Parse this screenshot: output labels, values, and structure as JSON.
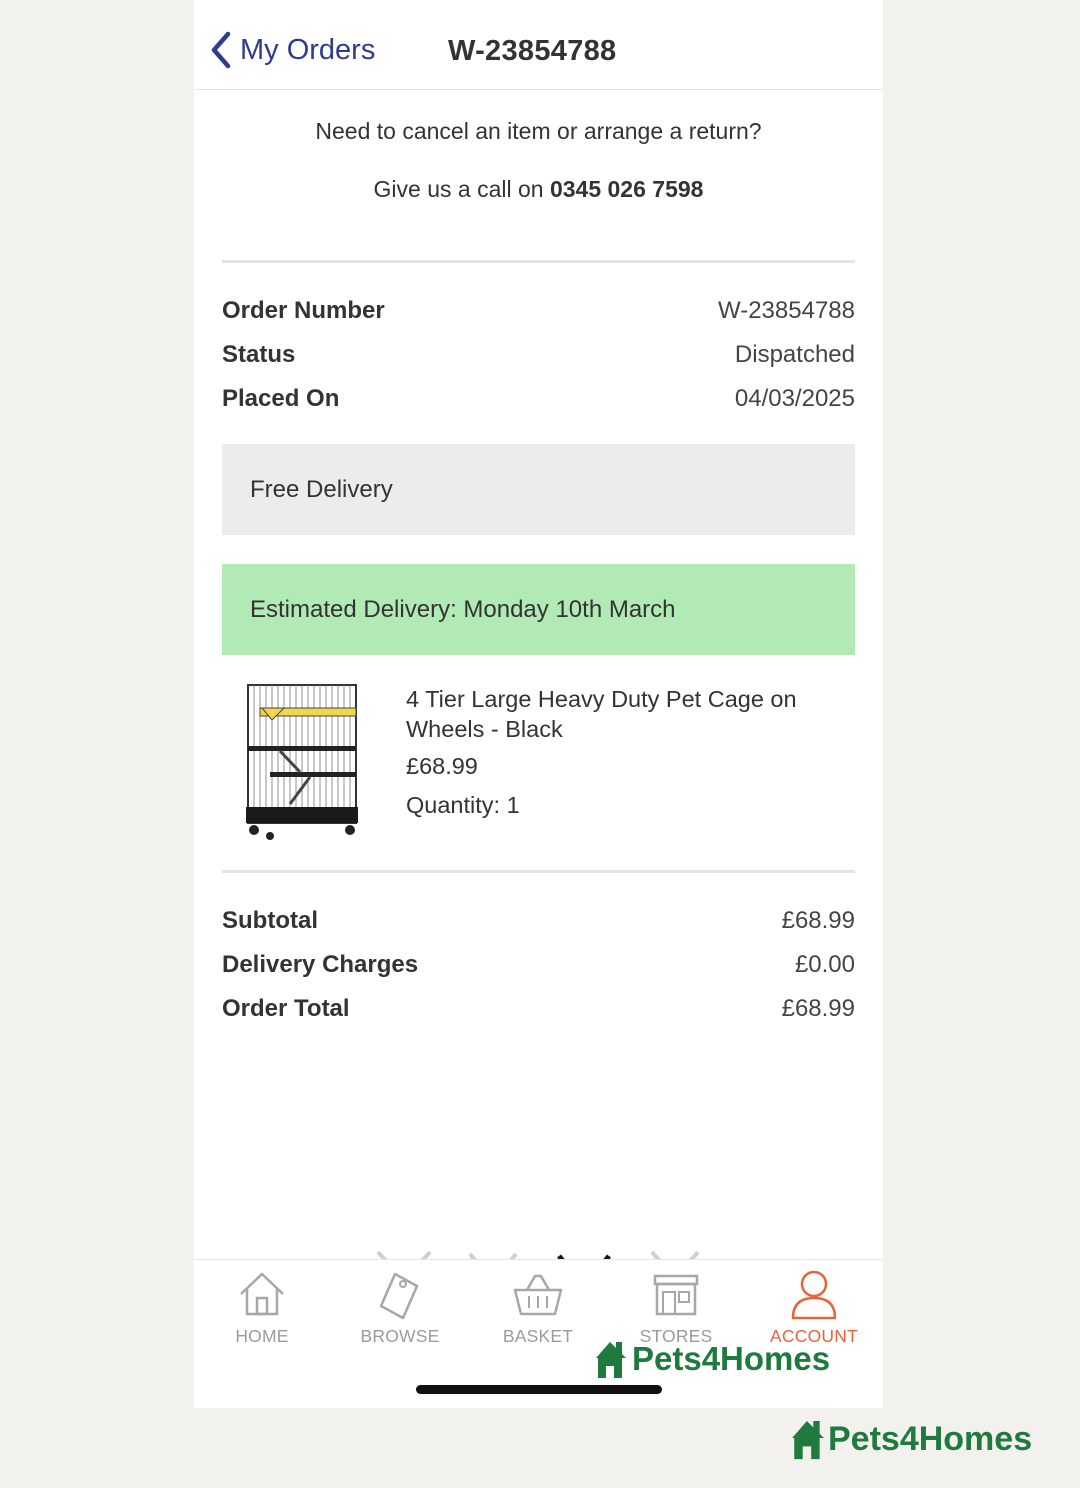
{
  "header": {
    "back_label": "My Orders",
    "order_id": "W-23854788"
  },
  "help": {
    "line1": "Need to cancel an item or arrange a return?",
    "line2_prefix": "Give us a call on ",
    "phone": "0345 026 7598"
  },
  "order": {
    "rows": [
      {
        "label": "Order Number",
        "value": "W-23854788"
      },
      {
        "label": "Status",
        "value": "Dispatched"
      },
      {
        "label": "Placed On",
        "value": "04/03/2025"
      }
    ]
  },
  "delivery": {
    "method": "Free Delivery",
    "estimate": "Estimated Delivery: Monday 10th March"
  },
  "item": {
    "name": "4 Tier Large Heavy Duty Pet Cage on Wheels - Black",
    "price": "£68.99",
    "quantity": "Quantity: 1"
  },
  "totals": [
    {
      "label": "Subtotal",
      "value": "£68.99"
    },
    {
      "label": "Delivery Charges",
      "value": "£0.00"
    },
    {
      "label": "Order Total",
      "value": "£68.99"
    }
  ],
  "tabs": [
    {
      "label": "HOME",
      "icon": "house-icon",
      "active": false
    },
    {
      "label": "BROWSE",
      "icon": "tag-icon",
      "active": false
    },
    {
      "label": "BASKET",
      "icon": "basket-icon",
      "active": false
    },
    {
      "label": "STORES",
      "icon": "store-icon",
      "active": false
    },
    {
      "label": "ACCOUNT",
      "icon": "user-icon",
      "active": true
    }
  ],
  "watermark": {
    "brand": "Pets4Homes"
  },
  "colors": {
    "accent_blue": "#2f3b8f",
    "active_tab": "#e8633a",
    "estimate_bg": "#b1eab5",
    "delivery_bg": "#ececec",
    "brand_green": "#1f7a3e"
  }
}
